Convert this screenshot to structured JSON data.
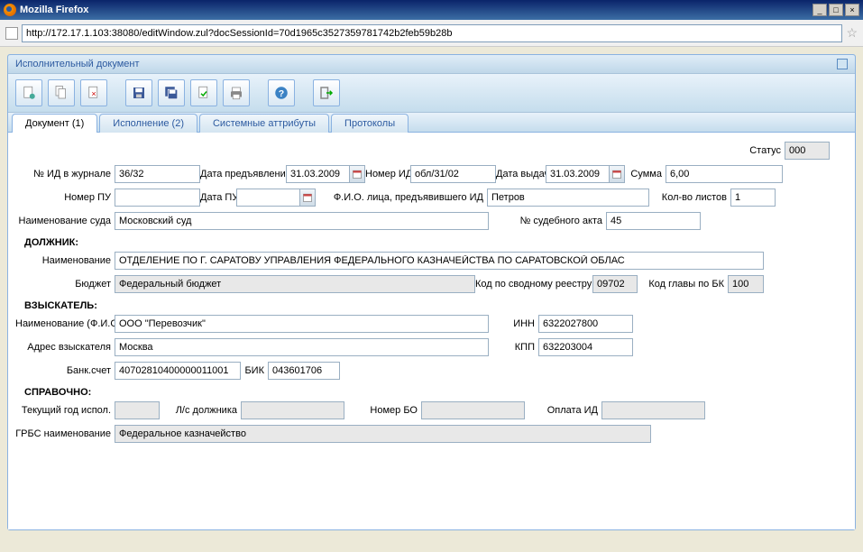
{
  "window": {
    "title": "Mozilla Firefox",
    "url": "http://172.17.1.103:38080/editWindow.zul?docSessionId=70d1965c3527359781742b2feb59b28b"
  },
  "panel": {
    "title": "Исполнительный документ"
  },
  "tabs": {
    "doc": "Документ (1)",
    "exec": "Исполнение (2)",
    "sys": "Системные аттрибуты",
    "proto": "Протоколы"
  },
  "labels": {
    "status": "Статус",
    "id_journal": "№ ИД в журнале",
    "date_present": "Дата предъявления ИД",
    "id_number": "Номер ИД",
    "date_issue": "Дата выдачи",
    "sum": "Сумма",
    "pu_number": "Номер ПУ",
    "pu_date": "Дата ПУ",
    "fio_presenter": "Ф.И.О. лица, предъявившего ИД",
    "sheets": "Кол-во листов",
    "court_name": "Наименование суда",
    "court_act": "№ судебного акта",
    "debtor": "ДОЛЖНИК:",
    "name": "Наименование",
    "budget": "Бюджет",
    "svod_code": "Код по сводному реестру",
    "bk_head": "Код главы по БК",
    "claimant": "ВЗЫСКАТЕЛЬ:",
    "name_fio": "Наименование (Ф.И.О.)",
    "inn": "ИНН",
    "claimant_addr": "Адрес взыскателя",
    "kpp": "КПП",
    "bank_acc": "Банк.счет",
    "bik": "БИК",
    "reference": "СПРАВОЧНО:",
    "current_year": "Текущий год испол.",
    "ls_debtor": "Л/с должника",
    "bo_number": "Номер БО",
    "oplata_id": "Оплата ИД",
    "grbs_name": "ГРБС наименование"
  },
  "values": {
    "status": "000",
    "id_journal": "36/32",
    "date_present": "31.03.2009",
    "id_number": "обл/31/02",
    "date_issue": "31.03.2009",
    "sum": "6,00",
    "pu_number": "",
    "pu_date": "",
    "fio_presenter": "Петров",
    "sheets": "1",
    "court_name": "Московский суд",
    "court_act": "45",
    "debtor_name": "ОТДЕЛЕНИЕ ПО Г. САРАТОВУ УПРАВЛЕНИЯ ФЕДЕРАЛЬНОГО КАЗНАЧЕЙСТВА ПО САРАТОВСКОЙ ОБЛАС",
    "budget": "Федеральный бюджет",
    "svod_code": "09702",
    "bk_head": "100",
    "claimant_name": "ООО \"Перевозчик\"",
    "inn": "6322027800",
    "claimant_addr": "Москва",
    "kpp": "632203004",
    "bank_acc": "40702810400000011001",
    "bik": "043601706",
    "current_year": "",
    "ls_debtor": "",
    "bo_number": "",
    "oplata_id": "",
    "grbs_name": "Федеральное казначейство"
  }
}
